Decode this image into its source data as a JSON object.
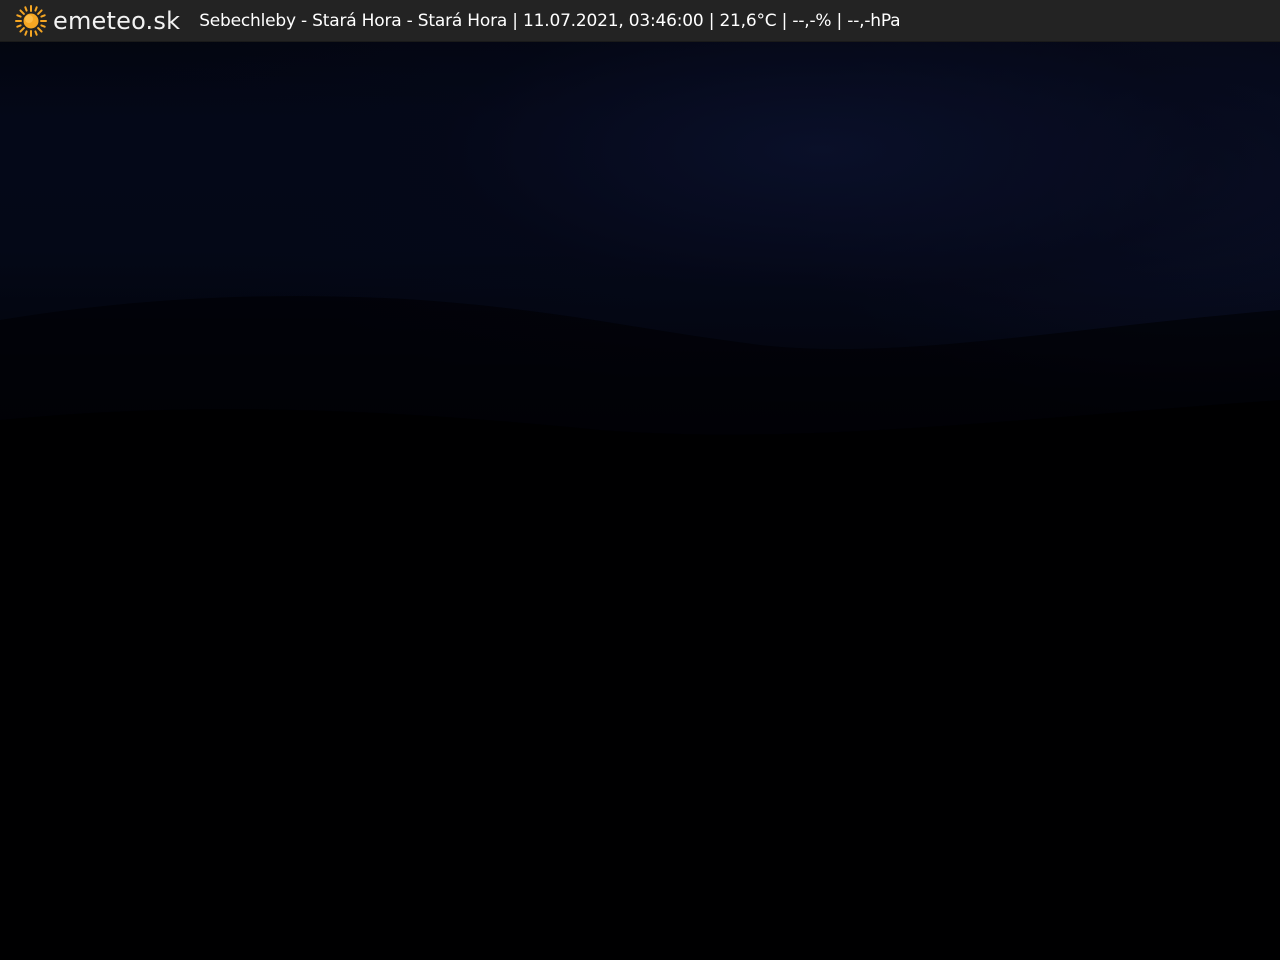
{
  "header": {
    "logo_icon": "sun-icon",
    "logo_text": "emeteo.sk",
    "info_text": "Sebechleby - Stará Hora - Stará Hora | 11.07.2021, 03:46:00 | 21,6°C | --,-% | --,-hPa"
  },
  "colors": {
    "bar_background": "#232323",
    "sun": "#f5a623",
    "text": "#ffffff"
  }
}
